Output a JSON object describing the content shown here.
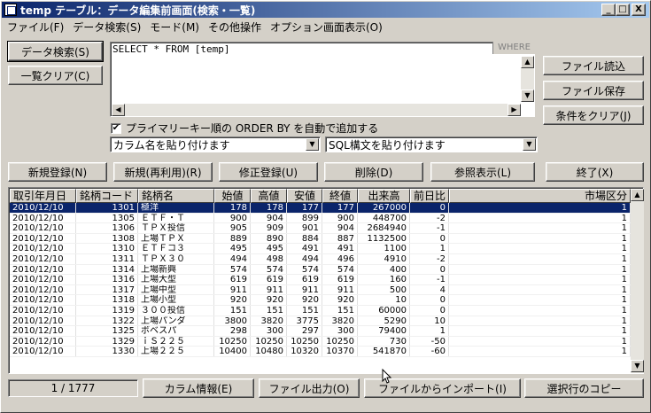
{
  "window": {
    "title": "temp テーブル：データ編集前画面(検索・一覧)",
    "min_glyph": "_",
    "max_glyph": "□",
    "close_glyph": "X"
  },
  "menu": [
    "ファイル(F)",
    "データ検索(S)",
    "モード(M)",
    "その他操作",
    "オプション画面表示(O)"
  ],
  "left_buttons": {
    "search": "データ検索(S)",
    "clear_list": "一覧クリア(C)"
  },
  "sql": {
    "text": "SELECT * FROM [temp]",
    "where_label": "WHERE"
  },
  "right_buttons": {
    "file_read": "ファイル読込",
    "file_save": "ファイル保存",
    "clear_cond": "条件をクリア(J)"
  },
  "checkbox": {
    "label": "プライマリーキー順の ORDER BY を自動で追加する",
    "checked": true,
    "check_glyph": "✔"
  },
  "combos": {
    "column_paste": "カラム名を貼り付けます",
    "sql_paste": "SQL構文を貼り付けます"
  },
  "action_buttons": [
    "新規登録(N)",
    "新規(再利用)(R)",
    "修正登録(U)",
    "削除(D)",
    "参照表示(L)",
    "終了(X)"
  ],
  "grid": {
    "columns": [
      "取引年月日",
      "銘柄コード",
      "銘柄名",
      "始値",
      "高値",
      "安値",
      "終値",
      "出来高",
      "前日比",
      "市場区分"
    ],
    "rows": [
      [
        "2010/12/10",
        "1301",
        "極洋",
        "178",
        "178",
        "177",
        "177",
        "267000",
        "0",
        "1"
      ],
      [
        "2010/12/10",
        "1305",
        "ＥＴＦ・Ｔ",
        "900",
        "904",
        "899",
        "900",
        "448700",
        "-2",
        "1"
      ],
      [
        "2010/12/10",
        "1306",
        "ＴＰＸ投信",
        "905",
        "909",
        "901",
        "904",
        "2684940",
        "-1",
        "1"
      ],
      [
        "2010/12/10",
        "1308",
        "上場ＴＰＸ",
        "889",
        "890",
        "884",
        "887",
        "1132500",
        "0",
        "1"
      ],
      [
        "2010/12/10",
        "1310",
        "ＥＴＦコ３",
        "495",
        "495",
        "491",
        "491",
        "1100",
        "1",
        "1"
      ],
      [
        "2010/12/10",
        "1311",
        "ＴＰＸ３０",
        "494",
        "498",
        "494",
        "496",
        "4910",
        "-2",
        "1"
      ],
      [
        "2010/12/10",
        "1314",
        "上場新興",
        "574",
        "574",
        "574",
        "574",
        "400",
        "0",
        "1"
      ],
      [
        "2010/12/10",
        "1316",
        "上場大型",
        "619",
        "619",
        "619",
        "619",
        "160",
        "-1",
        "1"
      ],
      [
        "2010/12/10",
        "1317",
        "上場中型",
        "911",
        "911",
        "911",
        "911",
        "500",
        "4",
        "1"
      ],
      [
        "2010/12/10",
        "1318",
        "上場小型",
        "920",
        "920",
        "920",
        "920",
        "10",
        "0",
        "1"
      ],
      [
        "2010/12/10",
        "1319",
        "３００投信",
        "151",
        "151",
        "151",
        "151",
        "60000",
        "0",
        "1"
      ],
      [
        "2010/12/10",
        "1322",
        "上場パンダ",
        "3800",
        "3820",
        "3775",
        "3820",
        "5290",
        "10",
        "1"
      ],
      [
        "2010/12/10",
        "1325",
        "ボベスパ",
        "298",
        "300",
        "297",
        "300",
        "79400",
        "1",
        "1"
      ],
      [
        "2010/12/10",
        "1329",
        "ｉＳ２２５",
        "10250",
        "10250",
        "10250",
        "10250",
        "730",
        "-50",
        "1"
      ],
      [
        "2010/12/10",
        "1330",
        "上場２２５",
        "10400",
        "10480",
        "10320",
        "10370",
        "541870",
        "-60",
        "1"
      ]
    ]
  },
  "status": {
    "record_position": "1 / 1777"
  },
  "bottom_buttons": [
    "カラム情報(E)",
    "ファイル出力(O)",
    "ファイルからインポート(I)",
    "選択行のコピー"
  ],
  "scroll_glyphs": {
    "up": "▲",
    "down": "▼",
    "left": "◀",
    "right": "▶"
  }
}
